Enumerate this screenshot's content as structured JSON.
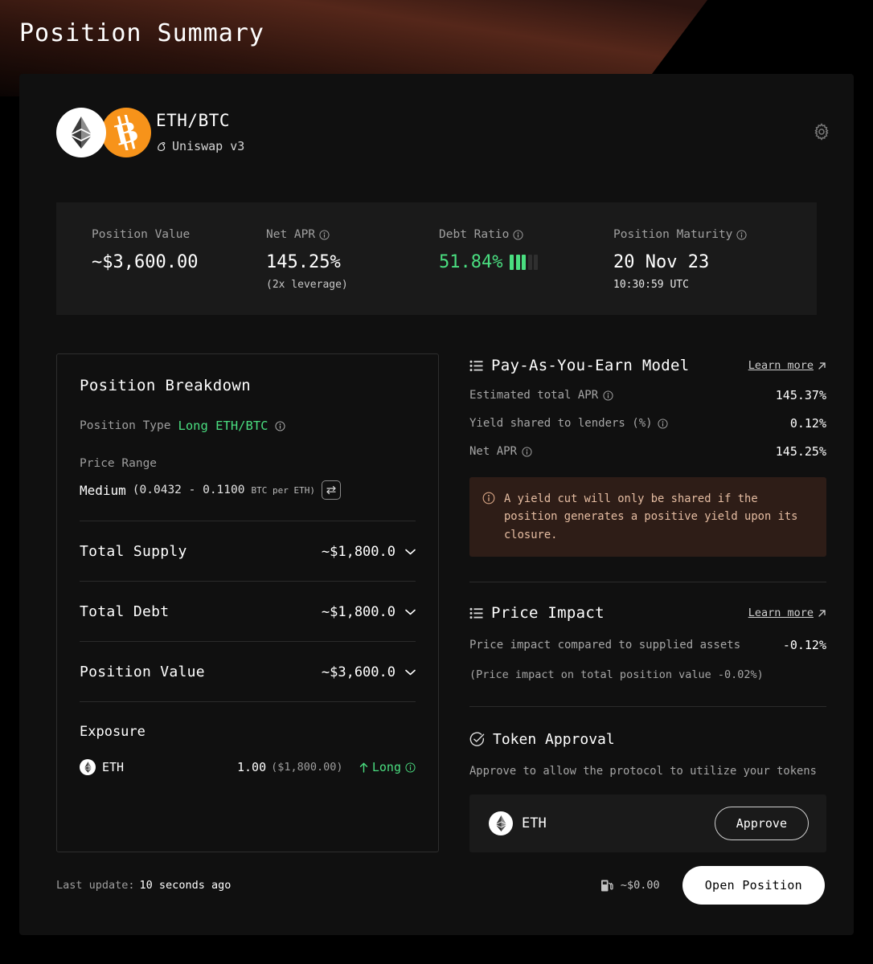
{
  "page": {
    "title": "Position Summary"
  },
  "header": {
    "pair": "ETH/BTC",
    "protocol": "Uniswap v3",
    "protocol_icon": "uniswap-unicorn-icon",
    "token_a": "ETH",
    "token_b": "BTC",
    "settings_icon": "gear-icon"
  },
  "stats": [
    {
      "label": "Position Value",
      "value": "~$3,600.00",
      "sub": "",
      "has_info": false
    },
    {
      "label": "Net APR",
      "value": "145.25%",
      "sub": "(2x leverage)",
      "has_info": true
    },
    {
      "label": "Debt Ratio",
      "value": "51.84%",
      "sub": "",
      "has_info": true,
      "bars_filled": 3,
      "bars_total": 5,
      "color": "#4ade80"
    },
    {
      "label": "Position Maturity",
      "value": "20 Nov 23",
      "sub": "10:30:59 UTC",
      "has_info": true
    }
  ],
  "breakdown": {
    "title": "Position Breakdown",
    "position_type_label": "Position Type",
    "position_type_value": "Long ETH/BTC",
    "price_range_label": "Price Range",
    "price_range_tier": "Medium",
    "price_range_bounds": "(0.0432 - 0.1100",
    "price_range_unit": "BTC per ETH)",
    "swap_icon": "swap-arrows-icon",
    "rows": [
      {
        "label": "Total Supply",
        "value": "~$1,800.0"
      },
      {
        "label": "Total Debt",
        "value": "~$1,800.0"
      },
      {
        "label": "Position Value",
        "value": "~$3,600.0"
      }
    ],
    "exposure_title": "Exposure",
    "exposure": {
      "token": "ETH",
      "amount": "1.00",
      "usd": "($1,800.00)",
      "direction": "Long"
    }
  },
  "paye": {
    "title": "Pay-As-You-Earn Model",
    "list_icon": "list-icon",
    "learn_more": "Learn more",
    "rows": [
      {
        "label": "Estimated total APR",
        "value": "145.37%"
      },
      {
        "label": "Yield shared to lenders (%)",
        "value": "0.12%"
      },
      {
        "label": "Net APR",
        "value": "145.25%"
      }
    ],
    "notice": "A yield cut will only be shared if the position generates a positive yield upon its closure."
  },
  "price_impact": {
    "title": "Price Impact",
    "list_icon": "list-icon",
    "learn_more": "Learn more",
    "row_label": "Price impact compared to supplied assets",
    "row_value": "-0.12%",
    "note": "(Price impact on total position value -0.02%)"
  },
  "token_approval": {
    "title": "Token Approval",
    "check_icon": "check-circle-icon",
    "description": "Approve to allow the protocol to utilize your tokens",
    "token": "ETH",
    "approve_label": "Approve"
  },
  "footer": {
    "last_update_label": "Last update:",
    "last_update_value": "10 seconds ago",
    "gas_icon": "gas-pump-icon",
    "gas_value": "~$0.00",
    "open_position_label": "Open Position"
  },
  "colors": {
    "accent_green": "#4ade80",
    "btc_orange": "#f7931a",
    "notice_bg": "#2e1d17",
    "notice_text": "#e6bda2",
    "card_bg": "#101010",
    "strip_bg": "#1a1a1a"
  }
}
